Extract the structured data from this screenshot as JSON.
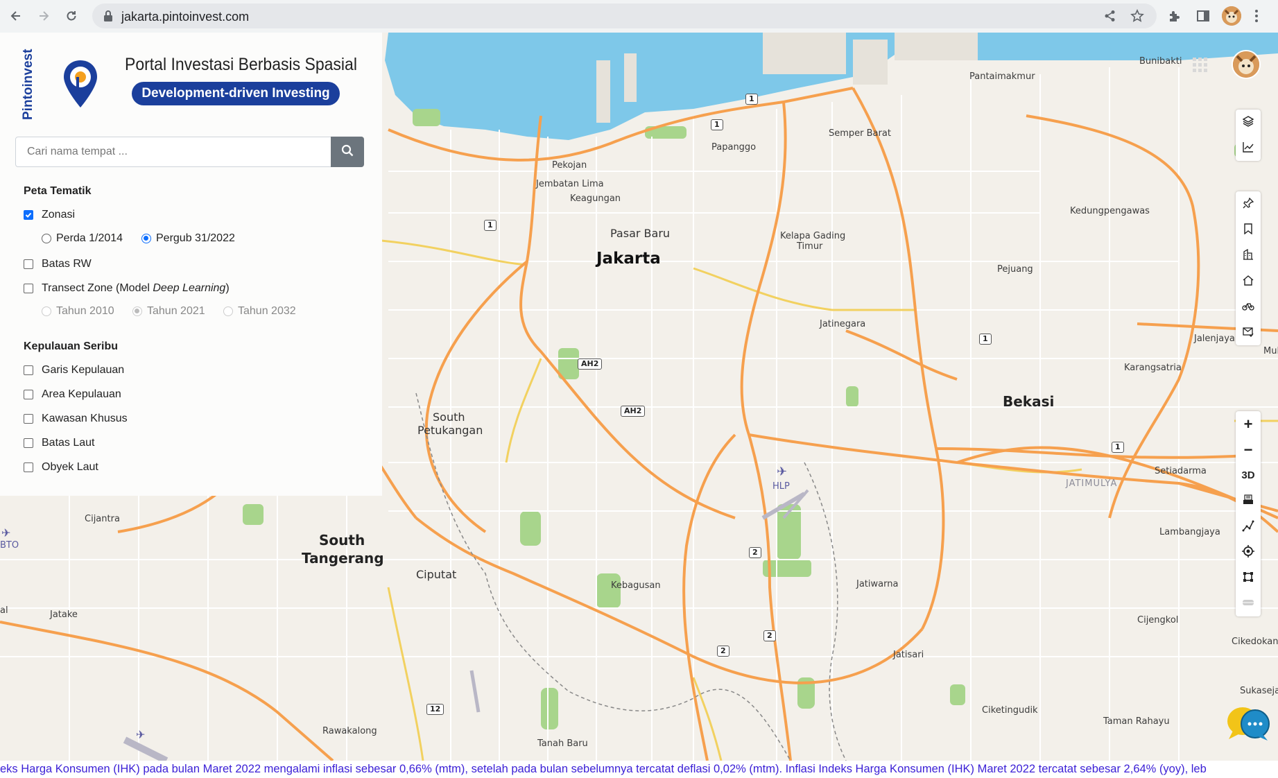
{
  "browser": {
    "url": "jakarta.pintoinvest.com"
  },
  "brand": {
    "side_text": "Pintoinvest",
    "title": "Portal Investasi Berbasis Spasial",
    "tagline": "Development-driven Investing",
    "accent": "#1b3f9c"
  },
  "search": {
    "placeholder": "Cari nama tempat ..."
  },
  "thematic": {
    "heading": "Peta Tematik",
    "zonasi": {
      "label": "Zonasi",
      "checked": true
    },
    "zonasi_options": [
      {
        "label": "Perda 1/2014",
        "selected": false
      },
      {
        "label": "Pergub 31/2022",
        "selected": true
      }
    ],
    "batas_rw": {
      "label": "Batas RW",
      "checked": false
    },
    "transect": {
      "label_prefix": "Transect Zone (Model ",
      "label_em": "Deep Learning",
      "label_suffix": ")",
      "checked": false
    },
    "transect_years": [
      {
        "label": "Tahun 2010",
        "selected": false
      },
      {
        "label": "Tahun 2021",
        "selected": true
      },
      {
        "label": "Tahun 2032",
        "selected": false
      }
    ]
  },
  "seribu": {
    "heading": "Kepulauan Seribu",
    "items": [
      {
        "label": "Garis Kepulauan",
        "checked": false
      },
      {
        "label": "Area Kepulauan",
        "checked": false
      },
      {
        "label": "Kawasan Khusus",
        "checked": false
      },
      {
        "label": "Batas Laut",
        "checked": false
      },
      {
        "label": "Obyek Laut",
        "checked": false
      }
    ]
  },
  "map_labels": {
    "jakarta": "Jakarta",
    "bekasi": "Bekasi",
    "south_tangerang_1": "South",
    "south_tangerang_2": "Tangerang",
    "pasar_baru": "Pasar Baru",
    "ciputat": "Ciputat",
    "south_petukangan_1": "South",
    "south_petukangan_2": "Petukangan",
    "pekojan": "Pekojan",
    "jembatan_lima": "Jembatan Lima",
    "keagungan": "Keagungan",
    "papanggo": "Papanggo",
    "semper_barat": "Semper Barat",
    "pantaimakmur": "Pantaimakmur",
    "bunibakti": "Bunibakti",
    "kedungpengawas": "Kedungpengawas",
    "kelapa_gading_1": "Kelapa Gading",
    "kelapa_gading_2": "Timur",
    "pejuang": "Pejuang",
    "jatinegara": "Jatinegara",
    "jalenjaya": "Jalenjaya",
    "karangsatria": "Karangsatria",
    "setiadarma": "Setiadarma",
    "jatimulya": "JATIMULYA",
    "lambangjaya": "Lambangjaya",
    "hlp": "HLP",
    "jatiwarna": "Jatiwarna",
    "kebagusan": "Kebagusan",
    "cijantra": "Cijantra",
    "jatake": "Jatake",
    "jatisari": "Jatisari",
    "cijengkol": "Cijengkol",
    "cikedokan": "Cikedokan",
    "sukasejati": "Sukasejati",
    "ciketingudik": "Ciketingudik",
    "taman_rahayu": "Taman Rahayu",
    "rawakalong": "Rawakalong",
    "tanah_baru": "Tanah Baru",
    "mul": "Mul",
    "al": "al",
    "bto": "BTO"
  },
  "road_shields": [
    "1",
    "1",
    "1",
    "1",
    "1",
    "AH2",
    "AH2",
    "2",
    "2",
    "2",
    "12"
  ],
  "controls": {
    "zoom_in": "+",
    "zoom_out": "−",
    "mode_3d": "3D"
  },
  "ticker": {
    "text": "eks Harga Konsumen (IHK) pada bulan Maret 2022 mengalami inflasi sebesar 0,66% (mtm), setelah pada bulan sebelumnya tercatat deflasi 0,02% (mtm). Inflasi Indeks Harga Konsumen (IHK) Maret 2022 tercatat sebesar 2,64% (yoy), leb"
  },
  "colors": {
    "sea": "#7ec8e9",
    "land": "#f3f0ea",
    "major_road": "#f6a04e",
    "secondary_road": "#f2d160",
    "park": "#a8d58c",
    "ticker_text": "#3a1fd6"
  }
}
